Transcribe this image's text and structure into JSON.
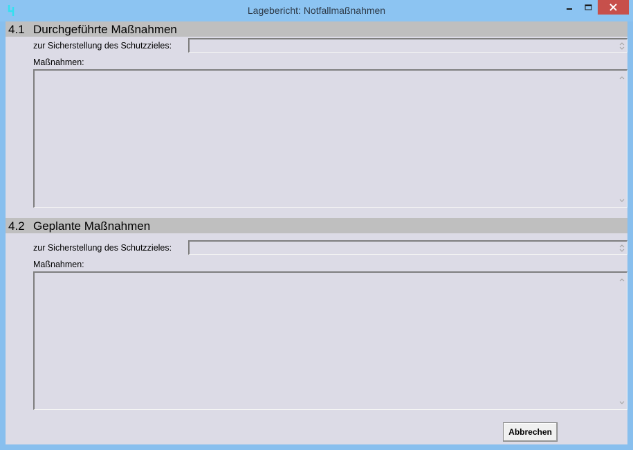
{
  "window": {
    "title": "Lagebericht: Notfallmaßnahmen"
  },
  "sections": [
    {
      "number": "4.1",
      "title": "Durchgeführte Maßnahmen",
      "goal_label": "zur Sicherstellung des Schutzzieles:",
      "goal_value": "",
      "measures_label": "Maßnahmen:",
      "measures_value": ""
    },
    {
      "number": "4.2",
      "title": "Geplante Maßnahmen",
      "goal_label": "zur Sicherstellung des Schutzzieles:",
      "goal_value": "",
      "measures_label": "Maßnahmen:",
      "measures_value": ""
    }
  ],
  "buttons": {
    "cancel": "Abbrechen"
  },
  "colors": {
    "titlebar": "#8cc4f2",
    "window_bg": "#dcdbe6",
    "section_header": "#bfbfbf",
    "close_button": "#c7504b"
  }
}
